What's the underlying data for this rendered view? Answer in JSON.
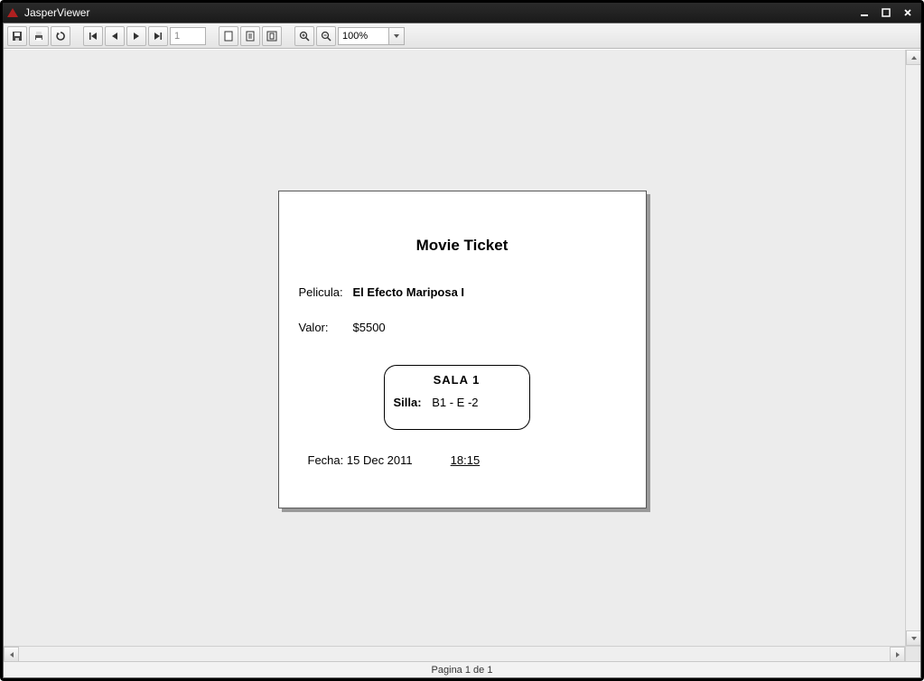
{
  "window": {
    "title": "JasperViewer"
  },
  "toolbar": {
    "page_input": "1",
    "zoom_value": "100%"
  },
  "report": {
    "title": "Movie Ticket",
    "pelicula_label": "Pelicula:",
    "pelicula_value": "El Efecto Mariposa I",
    "valor_label": "Valor:",
    "valor_value": "$5500",
    "sala_label": "SALA  1",
    "silla_label": "Silla:",
    "silla_value": "B1 - E   -2",
    "fecha_label": "Fecha:",
    "fecha_value": "15 Dec 2011",
    "time_value": "18:15"
  },
  "status": {
    "text": "Pagina 1 de 1"
  }
}
